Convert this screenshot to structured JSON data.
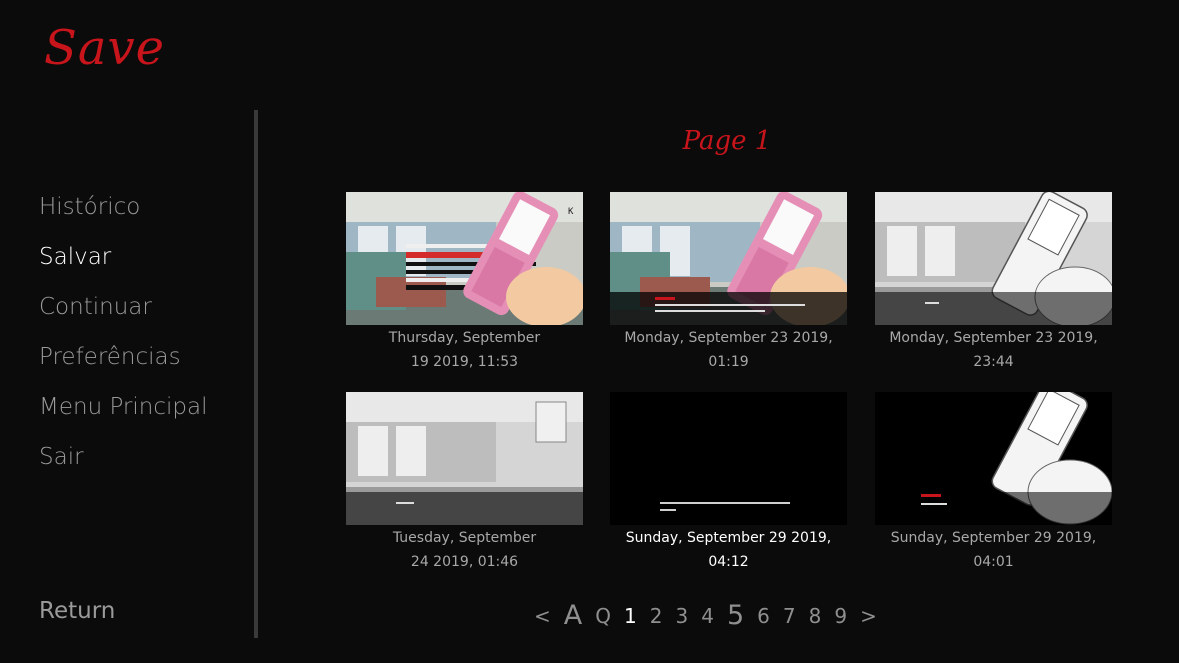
{
  "screen_title": "Save",
  "menu": {
    "items": [
      {
        "label": "Histórico",
        "active": false
      },
      {
        "label": "Salvar",
        "active": true
      },
      {
        "label": "Continuar",
        "active": false
      },
      {
        "label": "Preferências",
        "active": false
      },
      {
        "label": "Menu Principal",
        "active": false
      },
      {
        "label": "Sair",
        "active": false
      }
    ],
    "return_label": "Return"
  },
  "page_title": "Page 1",
  "slots": [
    {
      "label": "Thursday, September 19 2019, 11:53",
      "thumb": "hospital-menu"
    },
    {
      "label": "Monday, September 23 2019, 01:19",
      "thumb": "hospital-dialog"
    },
    {
      "label": "Monday, September 23 2019, 23:44",
      "thumb": "hospital-gray"
    },
    {
      "label": "Tuesday, September 24 2019, 01:46",
      "thumb": "hospital-gray-plain"
    },
    {
      "label": "Sunday, September 29 2019, 04:12",
      "thumb": "black-dialog",
      "highlighted": true
    },
    {
      "label": "Sunday, September 29 2019, 04:01",
      "thumb": "black-phone"
    }
  ],
  "pager": {
    "prev": "<",
    "auto": "A",
    "quick": "Q",
    "pages": [
      "1",
      "2",
      "3",
      "4",
      "5",
      "6",
      "7",
      "8",
      "9"
    ],
    "current": "1",
    "next": ">"
  },
  "colors": {
    "background": "#0b0b0b",
    "accent": "#c8141b",
    "text_idle": "#9a9a9a",
    "text_active": "#ffffff"
  }
}
